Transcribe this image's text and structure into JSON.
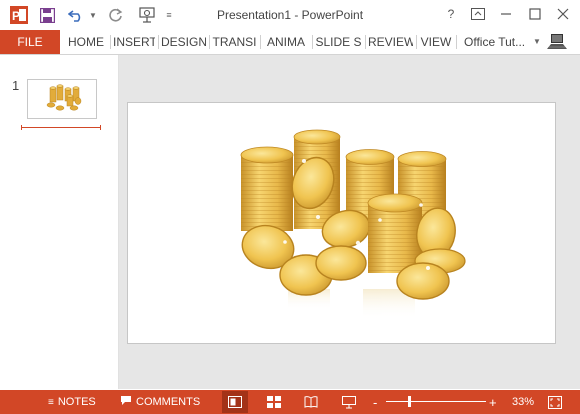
{
  "window": {
    "title": "Presentation1 - PowerPoint",
    "help": "?",
    "app_icon_letter": "P"
  },
  "ribbon": {
    "tabs": [
      "FILE",
      "HOME",
      "INSERT",
      "DESIGN",
      "TRANSI",
      "ANIMA",
      "SLIDE S",
      "REVIEW",
      "VIEW"
    ],
    "account": "Office Tut..."
  },
  "slides_pane": {
    "slide_number": "1"
  },
  "status": {
    "notes_label": "NOTES",
    "comments_label": "COMMENTS",
    "zoom_label": "33%",
    "zoom_minus": "-",
    "zoom_plus": "+",
    "zoom_fraction": 0.33
  },
  "colors": {
    "accent": "#d24726",
    "coin": "#e8b84a",
    "coin_dark": "#c8922a"
  }
}
